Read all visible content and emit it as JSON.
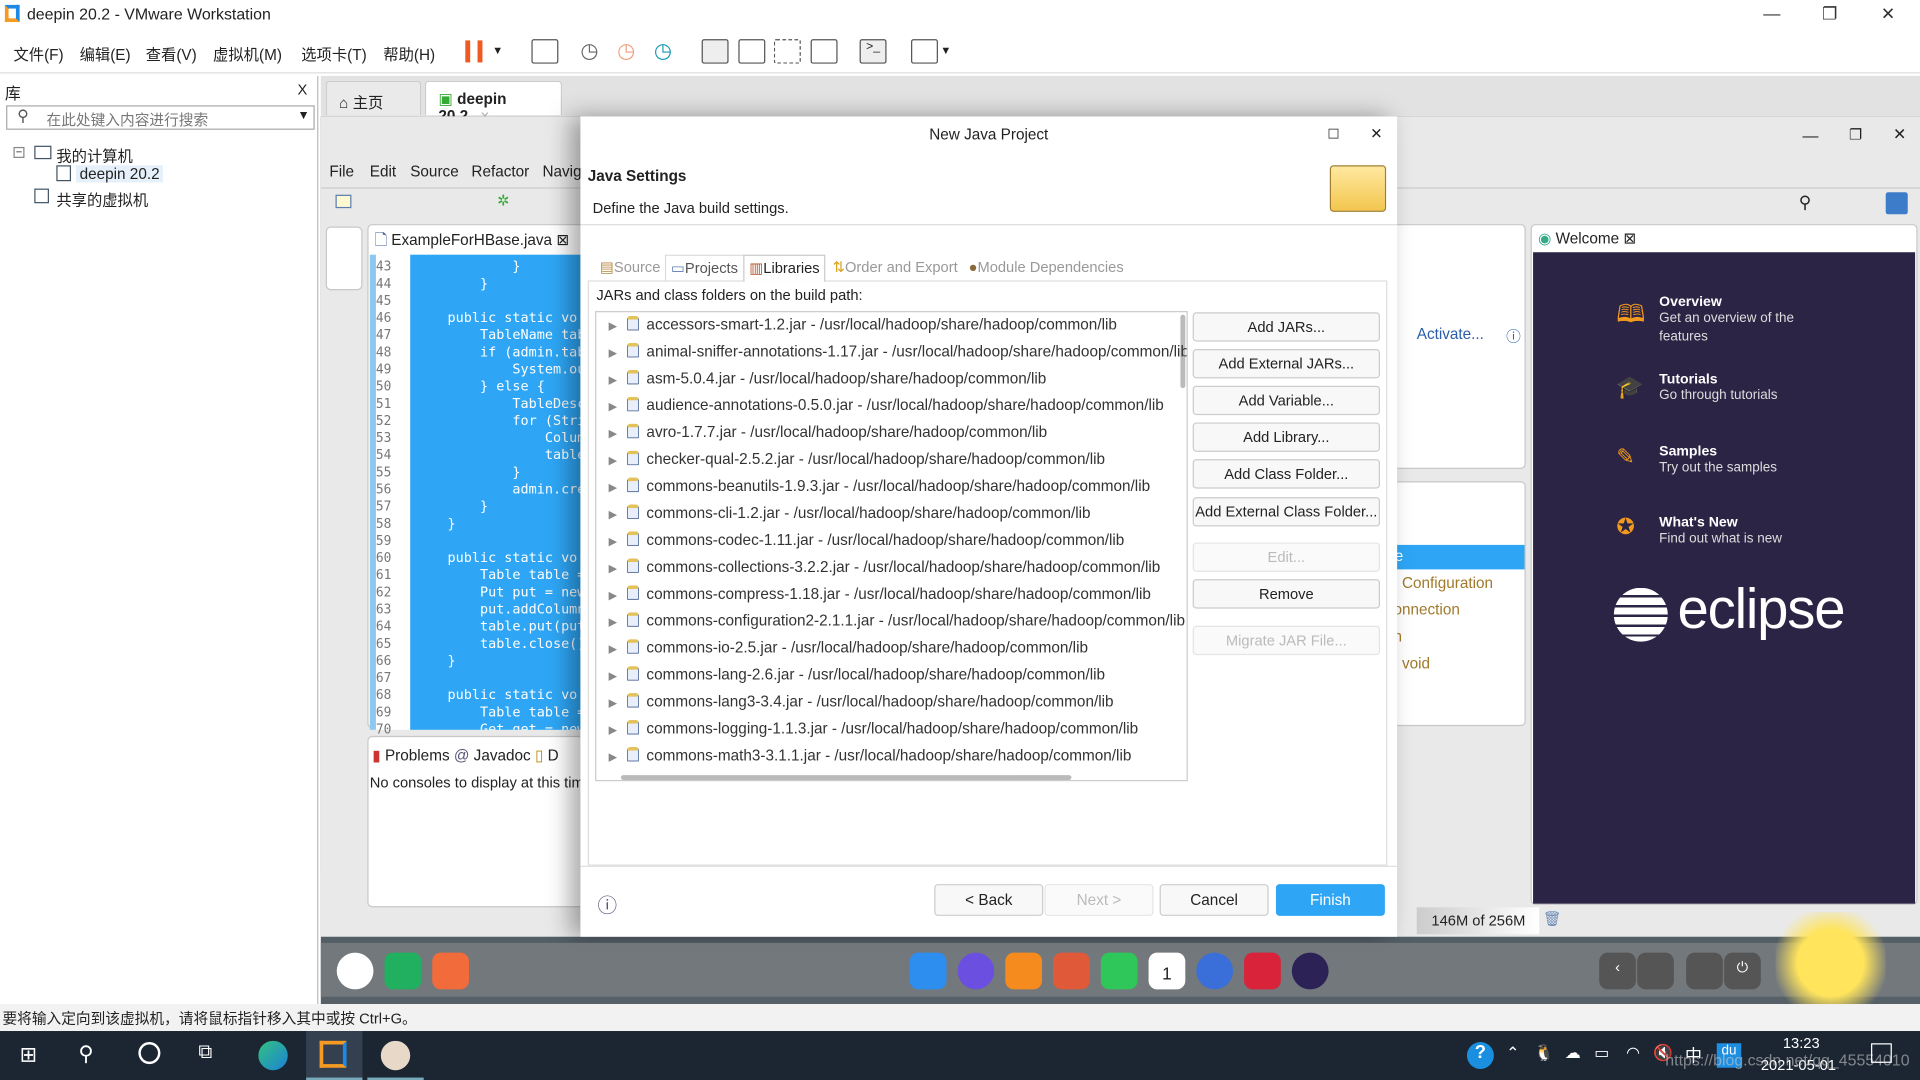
{
  "window": {
    "title": "deepin 20.2 - VMware Workstation"
  },
  "menu": [
    "文件(F)",
    "编辑(E)",
    "查看(V)",
    "虚拟机(M)",
    "选项卡(T)",
    "帮助(H)"
  ],
  "library": {
    "title": "库",
    "close": "X",
    "search_placeholder": "在此处键入内容进行搜索",
    "tree": [
      "我的计算机",
      "deepin 20.2",
      "共享的虚拟机"
    ]
  },
  "vm_tabs": [
    {
      "label": "主页"
    },
    {
      "label": "deepin 20.2"
    }
  ],
  "eclipse": {
    "menu": [
      "File",
      "Edit",
      "Source",
      "Refactor",
      "Navig"
    ],
    "editor_tab": "ExampleForHBase.java",
    "line_numbers": [
      "43",
      "44",
      "45",
      "46",
      "47",
      "48",
      "49",
      "50",
      "51",
      "52",
      "53",
      "54",
      "55",
      "56",
      "57",
      "58",
      "59",
      "60",
      "61",
      "62",
      "63",
      "64",
      "65",
      "66",
      "67",
      "68",
      "69",
      "70"
    ],
    "code_lines": [
      "            }",
      "        }",
      "",
      "    public static vo",
      "        TableName tab",
      "        if (admin.tab",
      "            System.ou",
      "        } else {",
      "            TableDesc",
      "            for (Stri",
      "                Colum",
      "                table",
      "            }",
      "            admin.cre",
      "        }",
      "    }",
      "",
      "    public static vo",
      "        Table table =",
      "        Put put = new",
      "        put.addColumn",
      "        table.put(put",
      "        table.close()",
      "    }",
      "",
      "    public static vo",
      "        Table table =",
      "        Get get = new"
    ],
    "bottom_tabs": [
      "Problems",
      "Javadoc",
      "D"
    ],
    "console_text": "No consoles to display at this time",
    "outline_link": "Activate...",
    "outline_items": [
      "e",
      ": Configuration",
      "onnection",
      "n",
      ": void"
    ],
    "heap": "146M of 256M",
    "welcome": {
      "tab": "Welcome",
      "items": [
        {
          "title": "Overview",
          "desc": "Get an overview of the features"
        },
        {
          "title": "Tutorials",
          "desc": "Go through tutorials"
        },
        {
          "title": "Samples",
          "desc": "Try out the samples"
        },
        {
          "title": "What's New",
          "desc": "Find out what is new"
        }
      ],
      "logo": "eclipse"
    }
  },
  "dialog": {
    "title": "New Java Project",
    "heading": "Java Settings",
    "description": "Define the Java build settings.",
    "tabs": [
      "Source",
      "Projects",
      "Libraries",
      "Order and Export",
      "Module Dependencies"
    ],
    "active_tab": "Libraries",
    "list_label": "JARs and class folders on the build path:",
    "jars": [
      "accessors-smart-1.2.jar - /usr/local/hadoop/share/hadoop/common/lib",
      "animal-sniffer-annotations-1.17.jar - /usr/local/hadoop/share/hadoop/common/lib",
      "asm-5.0.4.jar - /usr/local/hadoop/share/hadoop/common/lib",
      "audience-annotations-0.5.0.jar - /usr/local/hadoop/share/hadoop/common/lib",
      "avro-1.7.7.jar - /usr/local/hadoop/share/hadoop/common/lib",
      "checker-qual-2.5.2.jar - /usr/local/hadoop/share/hadoop/common/lib",
      "commons-beanutils-1.9.3.jar - /usr/local/hadoop/share/hadoop/common/lib",
      "commons-cli-1.2.jar - /usr/local/hadoop/share/hadoop/common/lib",
      "commons-codec-1.11.jar - /usr/local/hadoop/share/hadoop/common/lib",
      "commons-collections-3.2.2.jar - /usr/local/hadoop/share/hadoop/common/lib",
      "commons-compress-1.18.jar - /usr/local/hadoop/share/hadoop/common/lib",
      "commons-configuration2-2.1.1.jar - /usr/local/hadoop/share/hadoop/common/lib",
      "commons-io-2.5.jar - /usr/local/hadoop/share/hadoop/common/lib",
      "commons-lang-2.6.jar - /usr/local/hadoop/share/hadoop/common/lib",
      "commons-lang3-3.4.jar - /usr/local/hadoop/share/hadoop/common/lib",
      "commons-logging-1.1.3.jar - /usr/local/hadoop/share/hadoop/common/lib",
      "commons-math3-3.1.1.jar - /usr/local/hadoop/share/hadoop/common/lib"
    ],
    "side_buttons": [
      {
        "label": "Add JARs...",
        "enabled": true
      },
      {
        "label": "Add External JARs...",
        "enabled": true
      },
      {
        "label": "Add Variable...",
        "enabled": true
      },
      {
        "label": "Add Library...",
        "enabled": true
      },
      {
        "label": "Add Class Folder...",
        "enabled": true
      },
      {
        "label": "Add External Class Folder...",
        "enabled": true
      },
      {
        "label": "Edit...",
        "enabled": false
      },
      {
        "label": "Remove",
        "enabled": true
      },
      {
        "label": "Migrate JAR File...",
        "enabled": false
      }
    ],
    "footer": {
      "back": "< Back",
      "next": "Next >",
      "cancel": "Cancel",
      "finish": "Finish"
    },
    "accent": "#2ea6f5"
  },
  "statusbar": "要将输入定向到该虚拟机，请将鼠标指针移入其中或按 Ctrl+G。",
  "taskbar": {
    "time": "13:23",
    "date": "2021-05-01",
    "ime": "中",
    "watermark": "https://blog.csdn.net/qq_45554010"
  },
  "dock_date": "1"
}
